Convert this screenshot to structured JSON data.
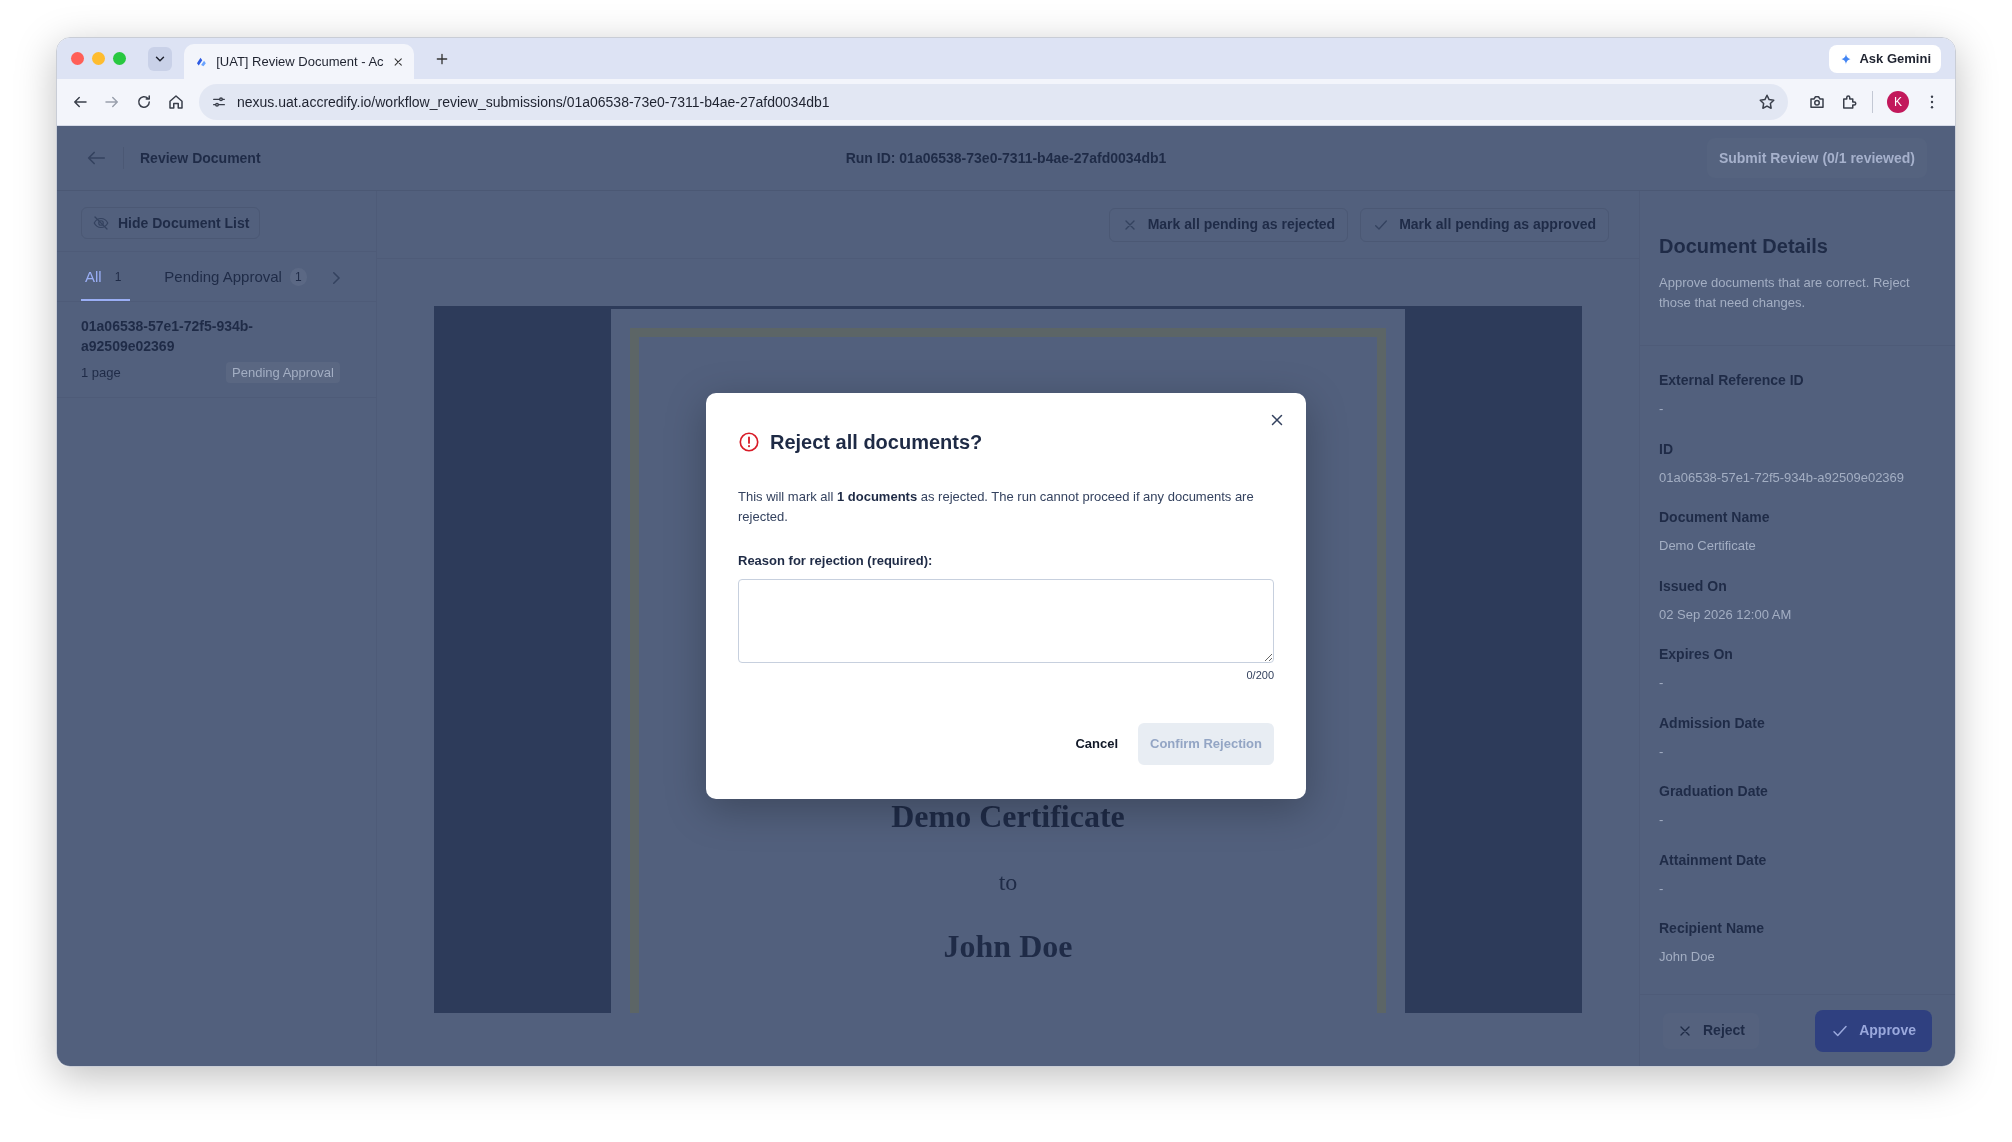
{
  "browser": {
    "tab_title": "[UAT] Review Document - Ac",
    "url": "nexus.uat.accredify.io/workflow_review_submissions/01a06538-73e0-7311-b4ae-27afd0034db1",
    "assistant_button": "Ask Gemini",
    "profile_initial": "K"
  },
  "header": {
    "title": "Review Document",
    "run_id": "Run ID: 01a06538-73e0-7311-b4ae-27afd0034db1",
    "submit_button": "Submit Review (0/1 reviewed)"
  },
  "hide_list_button": "Hide Document List",
  "tabs": [
    {
      "label": "All",
      "count": "1",
      "selected": true
    },
    {
      "label": "Pending Approval",
      "count": "1",
      "selected": false
    }
  ],
  "documents": [
    {
      "id": "01a06538-57e1-72f5-934b-a92509e02369",
      "pages": "1 page",
      "status": "Pending Approval"
    }
  ],
  "bulk_actions": [
    {
      "kind": "reject",
      "label": "Mark all pending as rejected"
    },
    {
      "kind": "approve",
      "label": "Mark all pending as approved"
    }
  ],
  "certificate": {
    "title": "Demo Certificate",
    "connector": "to",
    "recipient": "John Doe"
  },
  "details": {
    "title": "Document Details",
    "description": "Approve documents that are correct. Reject those that need changes.",
    "fields": [
      {
        "label": "External Reference ID",
        "value": "-"
      },
      {
        "label": "ID",
        "value": "01a06538-57e1-72f5-934b-a92509e02369"
      },
      {
        "label": "Document Name",
        "value": "Demo Certificate"
      },
      {
        "label": "Issued On",
        "value": "02 Sep 2026 12:00 AM"
      },
      {
        "label": "Expires On",
        "value": "-"
      },
      {
        "label": "Admission Date",
        "value": "-"
      },
      {
        "label": "Graduation Date",
        "value": "-"
      },
      {
        "label": "Attainment Date",
        "value": "-"
      },
      {
        "label": "Recipient Name",
        "value": "John Doe"
      }
    ]
  },
  "footer_actions": [
    {
      "kind": "reject",
      "label": "Reject"
    },
    {
      "kind": "approve",
      "label": "Approve"
    }
  ],
  "dialog": {
    "title": "Reject all documents?",
    "message": "This will mark all **1 documents** as rejected. The run cannot proceed if any documents are rejected.",
    "field_label": "Reason for rejection (required):",
    "counter": "0/200",
    "cancel": "Cancel",
    "confirm": "Confirm Rejection",
    "confirm_disabled": true
  }
}
